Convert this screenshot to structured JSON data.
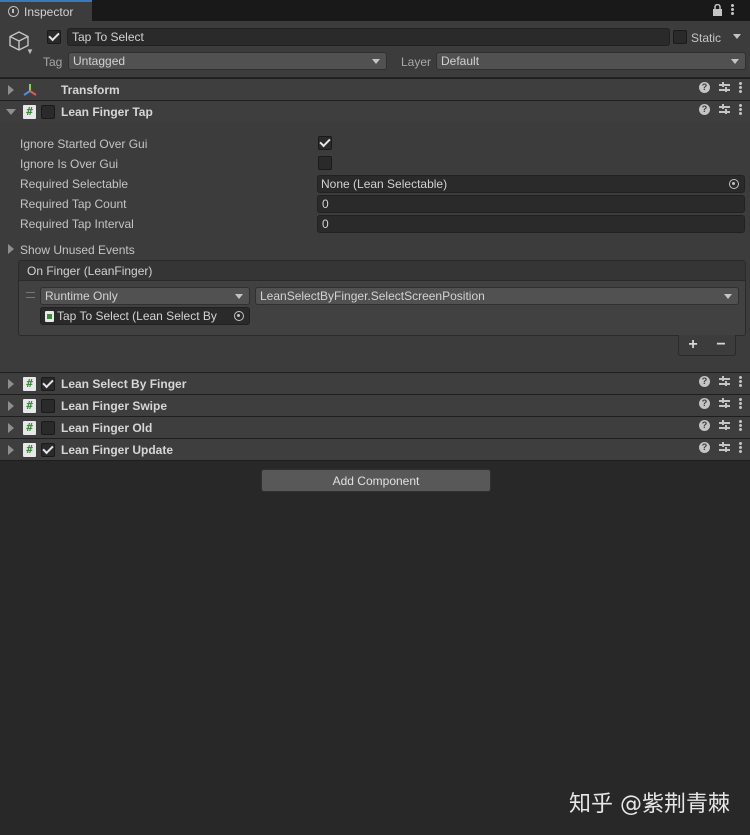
{
  "tab": {
    "title": "Inspector"
  },
  "gameobject": {
    "active": true,
    "name": "Tap To Select",
    "static_label": "Static",
    "static": false,
    "tag_label": "Tag",
    "tag_value": "Untagged",
    "layer_label": "Layer",
    "layer_value": "Default"
  },
  "components": [
    {
      "title": "Transform",
      "expanded": false,
      "has_checkbox": false
    },
    {
      "title": "Lean Finger Tap",
      "expanded": true,
      "enabled": false
    },
    {
      "title": "Lean Select By Finger",
      "expanded": false,
      "enabled": true
    },
    {
      "title": "Lean Finger Swipe",
      "expanded": false,
      "enabled": false
    },
    {
      "title": "Lean Finger Old",
      "expanded": false,
      "enabled": false
    },
    {
      "title": "Lean Finger Update",
      "expanded": false,
      "enabled": true
    }
  ],
  "finger_tap": {
    "ignore_started_over_gui": {
      "label": "Ignore Started Over Gui",
      "checked": true
    },
    "ignore_is_over_gui": {
      "label": "Ignore Is Over Gui",
      "checked": false
    },
    "required_selectable": {
      "label": "Required Selectable",
      "value": "None (Lean Selectable)"
    },
    "required_tap_count": {
      "label": "Required Tap Count",
      "value": "0"
    },
    "required_tap_interval": {
      "label": "Required Tap Interval",
      "value": "0"
    },
    "show_unused_events": "Show Unused Events",
    "event": {
      "header": "On Finger (LeanFinger)",
      "runtime_mode": "Runtime Only",
      "function": "LeanSelectByFinger.SelectScreenPosition",
      "target": "Tap To Select (Lean Select By",
      "add": "+",
      "remove": "−"
    }
  },
  "add_component": "Add Component",
  "watermark": "知乎 @紫荆青棘"
}
